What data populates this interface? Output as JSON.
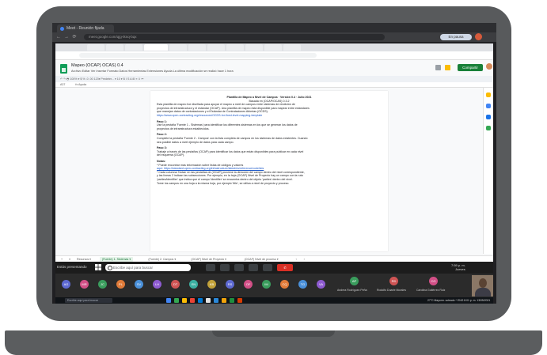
{
  "outer_browser": {
    "tab_title": "Meet - Reunión fijada",
    "url": "meet.google.com/qjg-tknq-bqx",
    "profile_label": "En pausa"
  },
  "sheet": {
    "title": "Mapeo (OCAP) OCAS) 0.4",
    "menu": "Archivo  Editar  Ver  Insertar  Formato  Datos  Herramientas  Extensiones  Ayuda   La última modificación se realizó hace 1 hora",
    "share_label": "Compartir",
    "toolbar": "↶ ↷ 🖶  100%  ▾   $  %  .0  .00  123▾   Predeter...  ▾   10  ▾   B  I  S  A   ⊞  ≡   ⇕   ↦",
    "cell_ref": "A37",
    "formula": "fx   Ayuda",
    "doc_lines": [
      {
        "text": "Plantilla de Mapeo a Nivel de Campos · Versión 0.4 · Julio 2021",
        "style": "center bold"
      },
      {
        "text": "Basada en (OCAP/OCAS) 0.3.2",
        "style": "center"
      },
      {
        "text": "Esta plantilla de mapeo fue diseñada para apoyar el mapeo a nivel de campos entre sistemas de rendición de",
        "style": ""
      },
      {
        "text": "proyectos de infraestructura y el estándar (OCAP). Una plantilla de mapeo está disponible para mapear entre estándares",
        "style": ""
      },
      {
        "text": "que manejan datos de contrataciones y el Estándar de Contrataciones Abiertas (OCDS).",
        "style": ""
      },
      {
        "text": "https://www.open-contracting.org/resources/OCDS-for-fixed-level-mapping-template",
        "style": "link"
      },
      {
        "text": "Paso 1:",
        "style": "bold"
      },
      {
        "text": "Use la pestaña 'Fuente 1 - Sistemas' para identificar los diferentes sistemas en los que se generan los datos de",
        "style": ""
      },
      {
        "text": "proyectos de infraestructura establecidos.",
        "style": ""
      },
      {
        "text": "Paso 2:",
        "style": "bold"
      },
      {
        "text": "Complete la pestaña 'Fuente 2 - Campos' con la lista completa de campos en los sistemas de datos existentes. Cuando",
        "style": ""
      },
      {
        "text": "sea posible datos a nivel ejemplo de datos para cada campo.",
        "style": ""
      },
      {
        "text": "Paso 3:",
        "style": "bold"
      },
      {
        "text": "Trabaje a través de las pestañas (OCAP) para identificar los datos que están disponibles para publicar en cada nivel",
        "style": ""
      },
      {
        "text": "del esquema (OCAP).",
        "style": ""
      },
      {
        "text": "Notas:",
        "style": "bold"
      },
      {
        "text": "* Puede encontrar más información sobre listas de códigos y valores",
        "style": ""
      },
      {
        "text": "aquí: https://standard.open-contracting.org/infrastructure/latest/es/reference/codelists",
        "style": "link"
      },
      {
        "text": "* Cada columna 'Notas' en las pestañas de (OCAP) proviene la dirección del campo dentro del nivel correspondiente,",
        "style": ""
      },
      {
        "text": "y las líneas 2 indican las subsecciones. Por ejemplo, en la hoja (OCAP) Nivel de Proyecto hay un campo con la ruta",
        "style": ""
      },
      {
        "text": "'parties/identifier' que indica que el campo 'identifier' se encuentra dentro del objeto 'parties' dentro del nivel.",
        "style": ""
      },
      {
        "text": "Tome los campos en una hoja a la misma hoja, por ejemplo 'title', se utiliza a nivel de proyecto y proceso.",
        "style": ""
      }
    ],
    "sheet_tabs": [
      "+",
      "≡",
      "Recursos ▾",
      "(Fuente) 1. Sistemas ▾",
      "(Fuente) 2. Campos ▾",
      "(OCAP) Nivel de Proyecto ▾",
      "(OCAP) Nivel de proceso ▾",
      "‹",
      "›"
    ]
  },
  "meeting_bar": {
    "presenter_label": "Estás presentando",
    "search_placeholder": "Escribe aquí para buscar",
    "stop_label": "Dejar de presentar",
    "tray_line1": "7:59 p. m.",
    "tray_line2": "Jueves",
    "tray_line3": "11/5/2021"
  },
  "participants": [
    {
      "initials": "AG",
      "color": "#5e6ad2"
    },
    {
      "initials": "MR",
      "color": "#d24f86"
    },
    {
      "initials": "JC",
      "color": "#3a9d5d"
    },
    {
      "initials": "PL",
      "color": "#e07b39"
    },
    {
      "initials": "SV",
      "color": "#4a90d9"
    },
    {
      "initials": "LH",
      "color": "#8e5bd1"
    },
    {
      "initials": "DT",
      "color": "#cf5454"
    },
    {
      "initials": "EN",
      "color": "#3bb0a1"
    },
    {
      "initials": "KB",
      "color": "#c2a23a"
    },
    {
      "initials": "RS",
      "color": "#5e6ad2"
    },
    {
      "initials": "OF",
      "color": "#d24f86"
    },
    {
      "initials": "IM",
      "color": "#3a9d5d"
    },
    {
      "initials": "CQ",
      "color": "#e07b39"
    },
    {
      "initials": "TG",
      "color": "#4a90d9"
    },
    {
      "initials": "VA",
      "color": "#8e5bd1"
    }
  ],
  "named_tiles": [
    {
      "initials": "AP",
      "color": "#3a9d5d",
      "name": "Andrea Rodríguez Peña"
    },
    {
      "initials": "RD",
      "color": "#cf5454",
      "name": "Rodolfo Duarte Morales"
    },
    {
      "initials": "CG",
      "color": "#d24f86",
      "name": "Carolina Gutiérrez Ruiz"
    }
  ],
  "taskbar": {
    "search_placeholder": "Escribe aquí para buscar",
    "tray_text": "27°C  Mayorm. soleado  ^  ENG  8:01 p. m.  13/05/2021"
  },
  "colors": {
    "laptop_frame": "#585a5c",
    "sheets_green": "#0f9d58",
    "share_green": "#188038",
    "stop_red": "#d93025",
    "link_blue": "#1a57c8"
  }
}
